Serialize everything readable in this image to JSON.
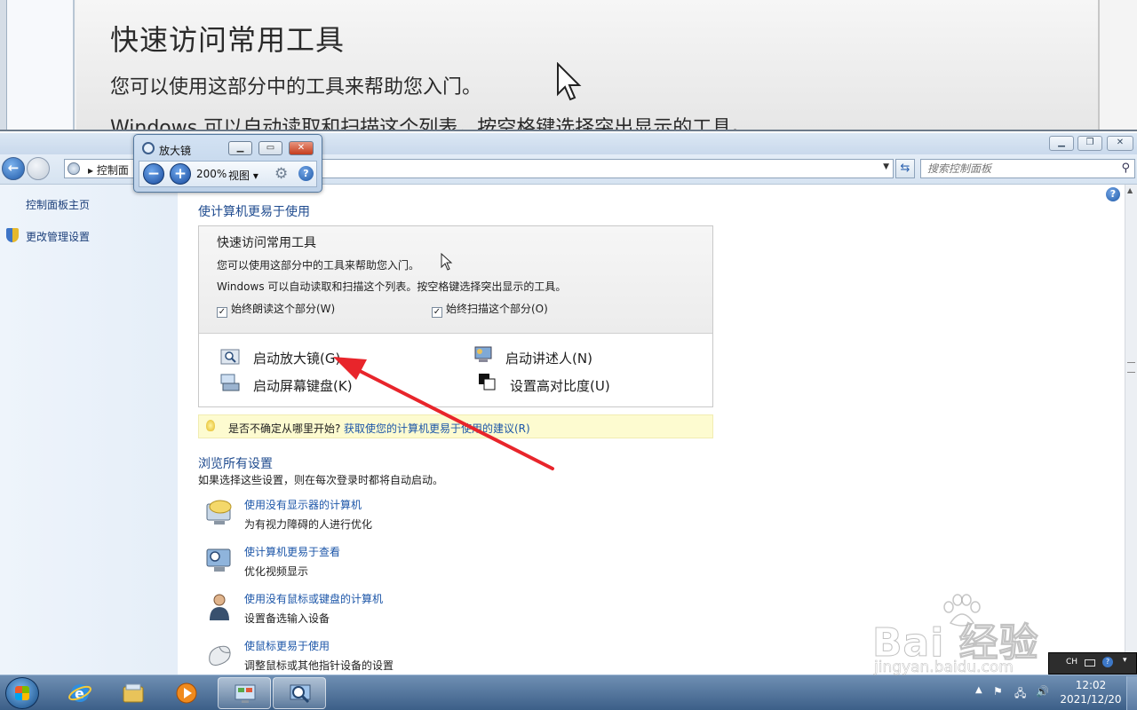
{
  "lens_view": {
    "heading": "快速访问常用工具",
    "line1": "您可以使用这部分中的工具来帮助您入门。",
    "line2_partial": "Windows 可以自动读取和扫描这个列表，按空格键选择突出显示的工具。"
  },
  "window": {
    "breadcrumb": "控制面",
    "search_placeholder": "搜索控制面板"
  },
  "left_nav": {
    "home": "控制面板主页",
    "admin": "更改管理设置"
  },
  "main": {
    "title": "使计算机更易于使用",
    "quick": {
      "heading": "快速访问常用工具",
      "desc1": "您可以使用这部分中的工具来帮助您入门。",
      "desc2": "Windows 可以自动读取和扫描这个列表。按空格键选择突出显示的工具。",
      "check_read": "始终朗读这个部分(W)",
      "check_scan": "始终扫描这个部分(O)",
      "tools": {
        "magnifier": "启动放大镜(G)",
        "narrator": "启动讲述人(N)",
        "keyboard": "启动屏幕键盘(K)",
        "contrast": "设置高对比度(U)"
      }
    },
    "tip": {
      "text": "是否不确定从哪里开始?",
      "link": "获取使您的计算机更易于使用的建议(R)"
    },
    "browse": {
      "title": "浏览所有设置",
      "desc": "如果选择这些设置，则在每次登录时都将自动启动。",
      "items": [
        {
          "link": "使用没有显示器的计算机",
          "desc": "为有视力障碍的人进行优化"
        },
        {
          "link": "使计算机更易于查看",
          "desc": "优化视频显示"
        },
        {
          "link": "使用没有鼠标或键盘的计算机",
          "desc": "设置备选输入设备"
        },
        {
          "link": "使鼠标更易于使用",
          "desc": "调整鼠标或其他指针设备的设置"
        }
      ]
    }
  },
  "magnifier": {
    "title": "放大镜",
    "zoom": "200%",
    "view_menu": "视图 ▾"
  },
  "tray": {
    "lang": "CH",
    "time": "12:02",
    "date": "2021/12/20"
  },
  "watermark": {
    "brand": "Bai 经验",
    "url": "jingyan.baidu.com"
  },
  "colors": {
    "link": "#1c56a8",
    "heading": "#1f4b8f",
    "annotation_arrow": "#e8252b"
  }
}
